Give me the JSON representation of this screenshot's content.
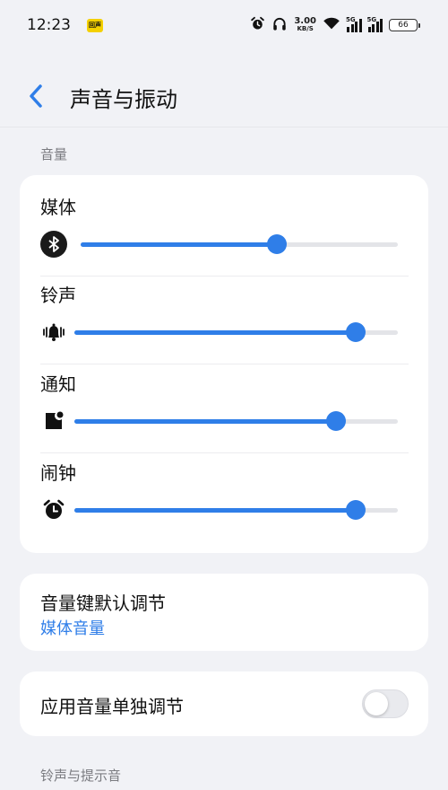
{
  "status_bar": {
    "time": "12:23",
    "app_badge": "回声",
    "net_speed_value": "3.00",
    "net_speed_unit": "KB/S",
    "signal1_tag": "5G",
    "signal2_tag": "5G",
    "battery": "66",
    "icons": [
      "alarm-icon",
      "headphones-icon",
      "wifi-icon",
      "signal-icon",
      "battery-icon"
    ]
  },
  "header": {
    "title": "声音与振动",
    "back_icon": "chevron-left-icon"
  },
  "volume_section": {
    "label": "音量",
    "rows": [
      {
        "label": "媒体",
        "icon": "bluetooth-icon",
        "level": 0.62
      },
      {
        "label": "铃声",
        "icon": "bell-icon",
        "level": 0.87
      },
      {
        "label": "通知",
        "icon": "notification-icon",
        "level": 0.81
      },
      {
        "label": "闹钟",
        "icon": "alarm-clock-icon",
        "level": 0.87
      }
    ]
  },
  "volume_key": {
    "title": "音量键默认调节",
    "value": "媒体音量"
  },
  "app_volume": {
    "title": "应用音量单独调节",
    "toggle_on": false
  },
  "ringtone_section": {
    "label": "铃声与提示音"
  },
  "colors": {
    "accent": "#2f7ee8",
    "background": "#f1f2f6",
    "card": "#ffffff"
  }
}
